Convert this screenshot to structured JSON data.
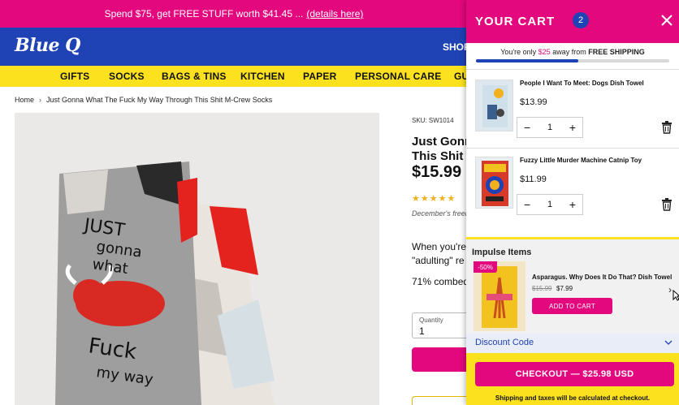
{
  "announcement": {
    "text": "Spend $75, get FREE STUFF worth $41.45 ...",
    "link": "(details here)"
  },
  "header": {
    "logo": "Blue Q",
    "shop_label": "SHOP"
  },
  "nav": {
    "items": [
      "GIFTS",
      "SOCKS",
      "BAGS & TINS",
      "KITCHEN",
      "PAPER",
      "PERSONAL CARE",
      "GU"
    ]
  },
  "breadcrumb": {
    "home": "Home",
    "current": "Just Gonna What The Fuck My Way Through This Shit M-Crew Socks"
  },
  "product": {
    "sku": "SKU: SW1014",
    "title_line1": "Just Gonn",
    "title_line2": "This Shit I",
    "price": "$15.99",
    "stars": "★★★★★",
    "freebie_note": "December's freeb",
    "desc_line1": "When you're",
    "desc_line2": "\"adulting\" re",
    "desc_line3": "71% combed",
    "quantity_label": "Quantity",
    "quantity_value": "1"
  },
  "cart": {
    "title": "YOUR CART",
    "count": "2",
    "shipping_prefix": "You're only ",
    "shipping_amount": "$25",
    "shipping_middle": " away from ",
    "shipping_bold": "FREE SHIPPING",
    "shipping_progress": 0.53,
    "items": [
      {
        "name": "People I Want To Meet: Dogs Dish Towel",
        "price": "$13.99",
        "qty": "1"
      },
      {
        "name": "Fuzzy Little Murder Machine Catnip Toy",
        "price": "$11.99",
        "qty": "1"
      }
    ],
    "impulse": {
      "title": "Impulse Items",
      "badge": "-50%",
      "name": "Asparagus. Why Does It Do That? Dish Towel",
      "old_price": "$15.99",
      "new_price": "$7.99",
      "add_label": "ADD TO CART"
    },
    "discount_label": "Discount Code",
    "checkout_label": "CHECKOUT — $25.98 USD",
    "checkout_note": "Shipping and taxes will be calculated at checkout."
  },
  "colors": {
    "brand_pink": "#e3087d",
    "brand_blue": "#1f42b4",
    "brand_yellow": "#fbe11e"
  }
}
